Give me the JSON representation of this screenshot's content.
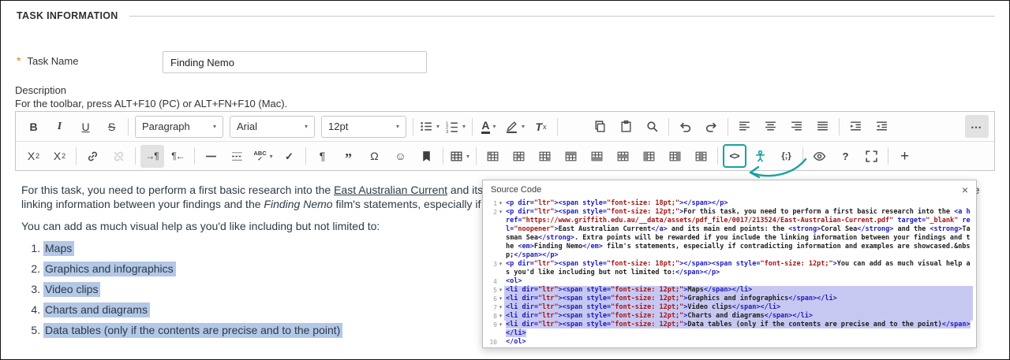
{
  "header": {
    "title": "TASK INFORMATION"
  },
  "task_form": {
    "required_marker": "*",
    "task_name": {
      "label": "Task Name",
      "value": "Finding Nemo"
    },
    "description": {
      "label": "Description",
      "toolbar_hint": "For the toolbar, press ALT+F10 (PC) or ALT+FN+F10 (Mac)."
    }
  },
  "icons": {
    "chevron_down": "▾",
    "fold_marker": "▾"
  },
  "colors": {
    "accent_teal": "#17a2a2",
    "editor_selection": "#b3c7e6",
    "code_selection": "#c7c8f2",
    "code_tag": "#1a1abc",
    "code_attr_value": "#a31515",
    "required_marker": "#e07b00"
  },
  "editor": {
    "toolbar": {
      "row1": [
        {
          "name": "bold-button",
          "glyph": "B",
          "cls": "gb"
        },
        {
          "name": "italic-button",
          "glyph": "I",
          "cls": "gi"
        },
        {
          "name": "underline-button",
          "glyph": "U",
          "cls": "gu"
        },
        {
          "name": "strikethrough-button",
          "glyph": "S",
          "cls": "gs"
        },
        {
          "sep": true
        },
        {
          "name": "format-select",
          "select": "Paragraph",
          "width": 112
        },
        {
          "name": "font-select",
          "select": "Arial",
          "width": 108
        },
        {
          "name": "fontsize-select",
          "select": "12pt",
          "width": 108
        },
        {
          "sep": true
        },
        {
          "name": "bullet-list-button",
          "svg": "list-ul",
          "dropdown": true
        },
        {
          "name": "numbered-list-button",
          "svg": "list-ol",
          "dropdown": true
        },
        {
          "sep": true
        },
        {
          "name": "text-color-button",
          "glyph": "A",
          "cls": "gcolor",
          "dropdown": true
        },
        {
          "name": "highlight-color-button",
          "svg": "pen",
          "dropdown": true
        },
        {
          "name": "clear-formatting-button",
          "glyph": "T",
          "sub": "x",
          "cls": "gtx"
        },
        {
          "sep": true
        },
        {
          "name": "cut-button",
          "svg": "cut"
        },
        {
          "name": "copy-button",
          "svg": "copy"
        },
        {
          "name": "paste-button",
          "svg": "paste"
        },
        {
          "name": "search-button",
          "svg": "search"
        },
        {
          "sep": true
        },
        {
          "name": "undo-button",
          "svg": "undo"
        },
        {
          "name": "redo-button",
          "svg": "redo"
        },
        {
          "sep": true
        },
        {
          "name": "align-left-button",
          "svg": "align-left"
        },
        {
          "name": "align-center-button",
          "svg": "align-center"
        },
        {
          "name": "align-right-button",
          "svg": "align-right"
        },
        {
          "name": "justify-button",
          "svg": "align-justify"
        },
        {
          "sep": true
        },
        {
          "name": "indent-button",
          "svg": "indent"
        },
        {
          "name": "outdent-button",
          "svg": "outdent"
        },
        {
          "name": "more-button",
          "glyph": "⋯",
          "cls": "gmore",
          "active": true,
          "push": true
        }
      ],
      "row2": [
        {
          "name": "superscript-button",
          "glyph": "X",
          "sup": "2"
        },
        {
          "name": "subscript-button",
          "glyph": "X",
          "sub": "2"
        },
        {
          "sep": true
        },
        {
          "name": "link-button",
          "svg": "link"
        },
        {
          "name": "unlink-button",
          "svg": "unlink",
          "disabled": true
        },
        {
          "sep": true
        },
        {
          "name": "ltr-button",
          "glyph": "→¶",
          "cls": "gdir",
          "active": true
        },
        {
          "name": "rtl-button",
          "glyph": "¶←",
          "cls": "gdir"
        },
        {
          "sep": true
        },
        {
          "name": "horizontal-rule-button",
          "svg": "hr"
        },
        {
          "name": "page-break-button",
          "svg": "page-break"
        },
        {
          "name": "spellcheck-button",
          "stack": [
            "ABC",
            "✓"
          ],
          "dropdown": true
        },
        {
          "name": "spellcheck-toggle-button",
          "glyph": "✓",
          "cls": "gcheck"
        },
        {
          "sep": true
        },
        {
          "name": "show-invisibles-button",
          "glyph": "¶"
        },
        {
          "name": "blockquote-button",
          "glyph": "”",
          "cls": "gquote"
        },
        {
          "name": "special-character-button",
          "glyph": "Ω"
        },
        {
          "name": "emoticons-button",
          "glyph": "☺"
        },
        {
          "name": "bookmark-button",
          "svg": "bookmark"
        },
        {
          "sep": true
        },
        {
          "name": "table-button",
          "svg": "table",
          "dropdown": true
        },
        {
          "sep": true
        },
        {
          "name": "cell-properties-button",
          "svg": "t-cell"
        },
        {
          "name": "merge-cells-button",
          "svg": "t-merge"
        },
        {
          "name": "split-cell-button",
          "svg": "t-split"
        },
        {
          "name": "row-before-button",
          "svg": "t-row-above"
        },
        {
          "name": "row-after-button",
          "svg": "t-row-below"
        },
        {
          "name": "delete-row-button",
          "svg": "t-del-row"
        },
        {
          "name": "col-before-button",
          "svg": "t-col-before"
        },
        {
          "name": "col-after-button",
          "svg": "t-col-after"
        },
        {
          "name": "delete-col-button",
          "svg": "t-del-col"
        },
        {
          "sep": true
        },
        {
          "name": "source-code-button",
          "glyph": "<>",
          "cls": "gcode",
          "accent": true
        },
        {
          "name": "accessibility-checker-button",
          "svg": "person"
        },
        {
          "name": "code-sample-button",
          "glyph": "{;}",
          "cls": "gsample"
        },
        {
          "sep": true
        },
        {
          "name": "preview-button",
          "svg": "eye"
        },
        {
          "name": "help-button",
          "glyph": "?",
          "cls": "ghelp"
        },
        {
          "name": "fullscreen-button",
          "svg": "fullscreen"
        },
        {
          "sep": true
        },
        {
          "name": "add-button",
          "glyph": "+",
          "cls": "gplus"
        }
      ]
    },
    "content": {
      "paragraph1": [
        {
          "text": "For this task, you need to perform a first basic research into the "
        },
        {
          "text": "East Australian Current",
          "style": "link"
        },
        {
          "text": " and its main end points: the "
        },
        {
          "text": "Coral Sea",
          "style": "bold"
        },
        {
          "text": " and the "
        },
        {
          "text": "Tasman Sea",
          "style": "bold"
        },
        {
          "text": ". Extra points will be rewarded if you include the linking information between your findings and the "
        },
        {
          "text": "Finding Nemo",
          "style": "em"
        },
        {
          "text": " film's statements, especially if contradicting information and examples are showcased."
        }
      ],
      "paragraph2": "You can add as much visual help as you'd like including but not limited to:",
      "list_items": [
        "Maps",
        "Graphics and infographics",
        "Video clips",
        "Charts and diagrams",
        "Data tables (only if the contents are precise and to the point)"
      ]
    }
  },
  "source_dialog": {
    "title": "Source Code",
    "close_glyph": "×",
    "lines": [
      {
        "num": 1,
        "fold": true,
        "selected": false,
        "code": "<p dir=\"ltr\"><span style=\"font-size: 18pt;\"></span></p>"
      },
      {
        "num": 2,
        "fold": true,
        "selected": false,
        "code": "<p dir=\"ltr\"><span style=\"font-size: 12pt;\">For this task, you need to perform a first basic research into the <a href=\"https://www.griffith.edu.au/__data/assets/pdf_file/0017/213524/East-Australian-Current.pdf\" target=\"_blank\" rel=\"noopener\">East Australian Current</a> and its main end points: the <strong>Coral Sea</strong> and the <strong>Tasman Sea</strong>. Extra points will be rewarded if you include the linking information between your findings and the <em>Finding Nemo</em> film's statements, especially if contradicting information and examples are showcased.&nbsp;</span></p>"
      },
      {
        "num": 3,
        "fold": true,
        "selected": false,
        "code": "<p dir=\"ltr\"><span style=\"font-size: 18pt;\"></span><span style=\"font-size: 12pt;\">You can add as much visual help as you'd like including but not limited to:</span></p>"
      },
      {
        "num": 4,
        "fold": false,
        "selected": false,
        "code": "<ol>"
      },
      {
        "num": 5,
        "fold": true,
        "selected": true,
        "code": "<li dir=\"ltr\"><span style=\"font-size: 12pt;\">Maps</span></li>"
      },
      {
        "num": 6,
        "fold": true,
        "selected": true,
        "code": "<li dir=\"ltr\"><span style=\"font-size: 12pt;\">Graphics and infographics</span></li>"
      },
      {
        "num": 7,
        "fold": true,
        "selected": true,
        "code": "<li dir=\"ltr\"><span style=\"font-size: 12pt;\">Video clips</span></li>"
      },
      {
        "num": 8,
        "fold": true,
        "selected": true,
        "code": "<li dir=\"ltr\"><span style=\"font-size: 12pt;\">Charts and diagrams</span></li>"
      },
      {
        "num": 9,
        "fold": true,
        "selected": "text",
        "code": "<li dir=\"ltr\"><span style=\"font-size: 12pt;\">Data tables (only if the contents are precise and to the point)</span></li>"
      },
      {
        "num": 10,
        "fold": false,
        "selected": false,
        "code": "</ol>"
      }
    ]
  }
}
